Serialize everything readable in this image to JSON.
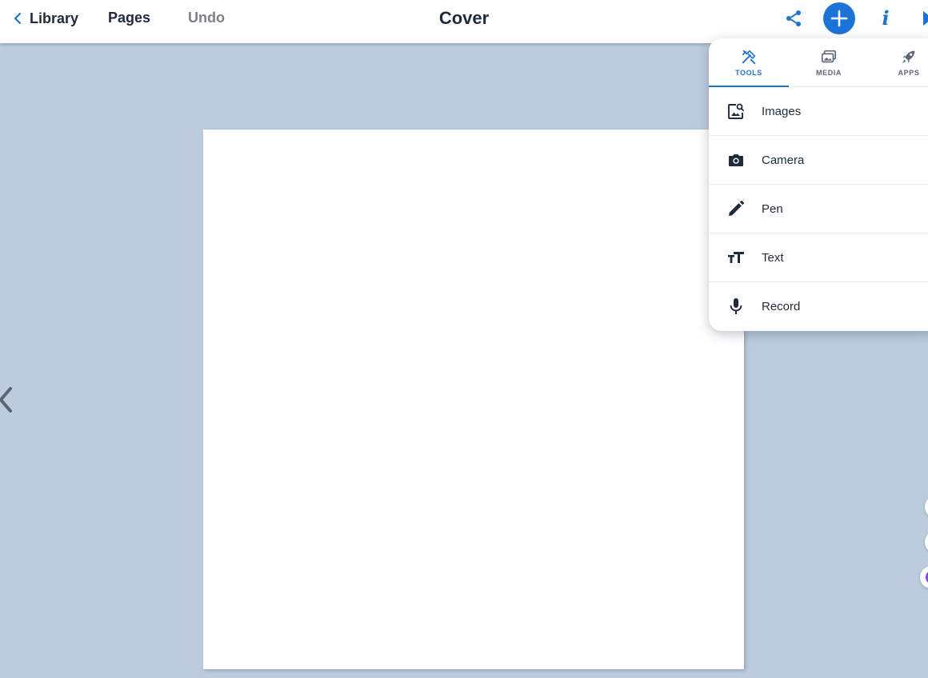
{
  "topbar": {
    "back_label": "Library",
    "pages_label": "Pages",
    "undo_label": "Undo",
    "title": "Cover"
  },
  "colors": {
    "accent": "#1a73d9",
    "background": "#bccbdd",
    "text": "#1f2a3d"
  },
  "panel": {
    "tabs": [
      {
        "label": "TOOLS",
        "icon": "tools-icon",
        "active": true
      },
      {
        "label": "MEDIA",
        "icon": "media-icon",
        "active": false
      },
      {
        "label": "APPS",
        "icon": "rocket-icon",
        "active": false
      }
    ],
    "items": [
      {
        "label": "Images",
        "icon": "image-search-icon"
      },
      {
        "label": "Camera",
        "icon": "camera-icon"
      },
      {
        "label": "Pen",
        "icon": "pen-icon"
      },
      {
        "label": "Text",
        "icon": "text-size-icon"
      },
      {
        "label": "Record",
        "icon": "microphone-icon"
      }
    ]
  }
}
